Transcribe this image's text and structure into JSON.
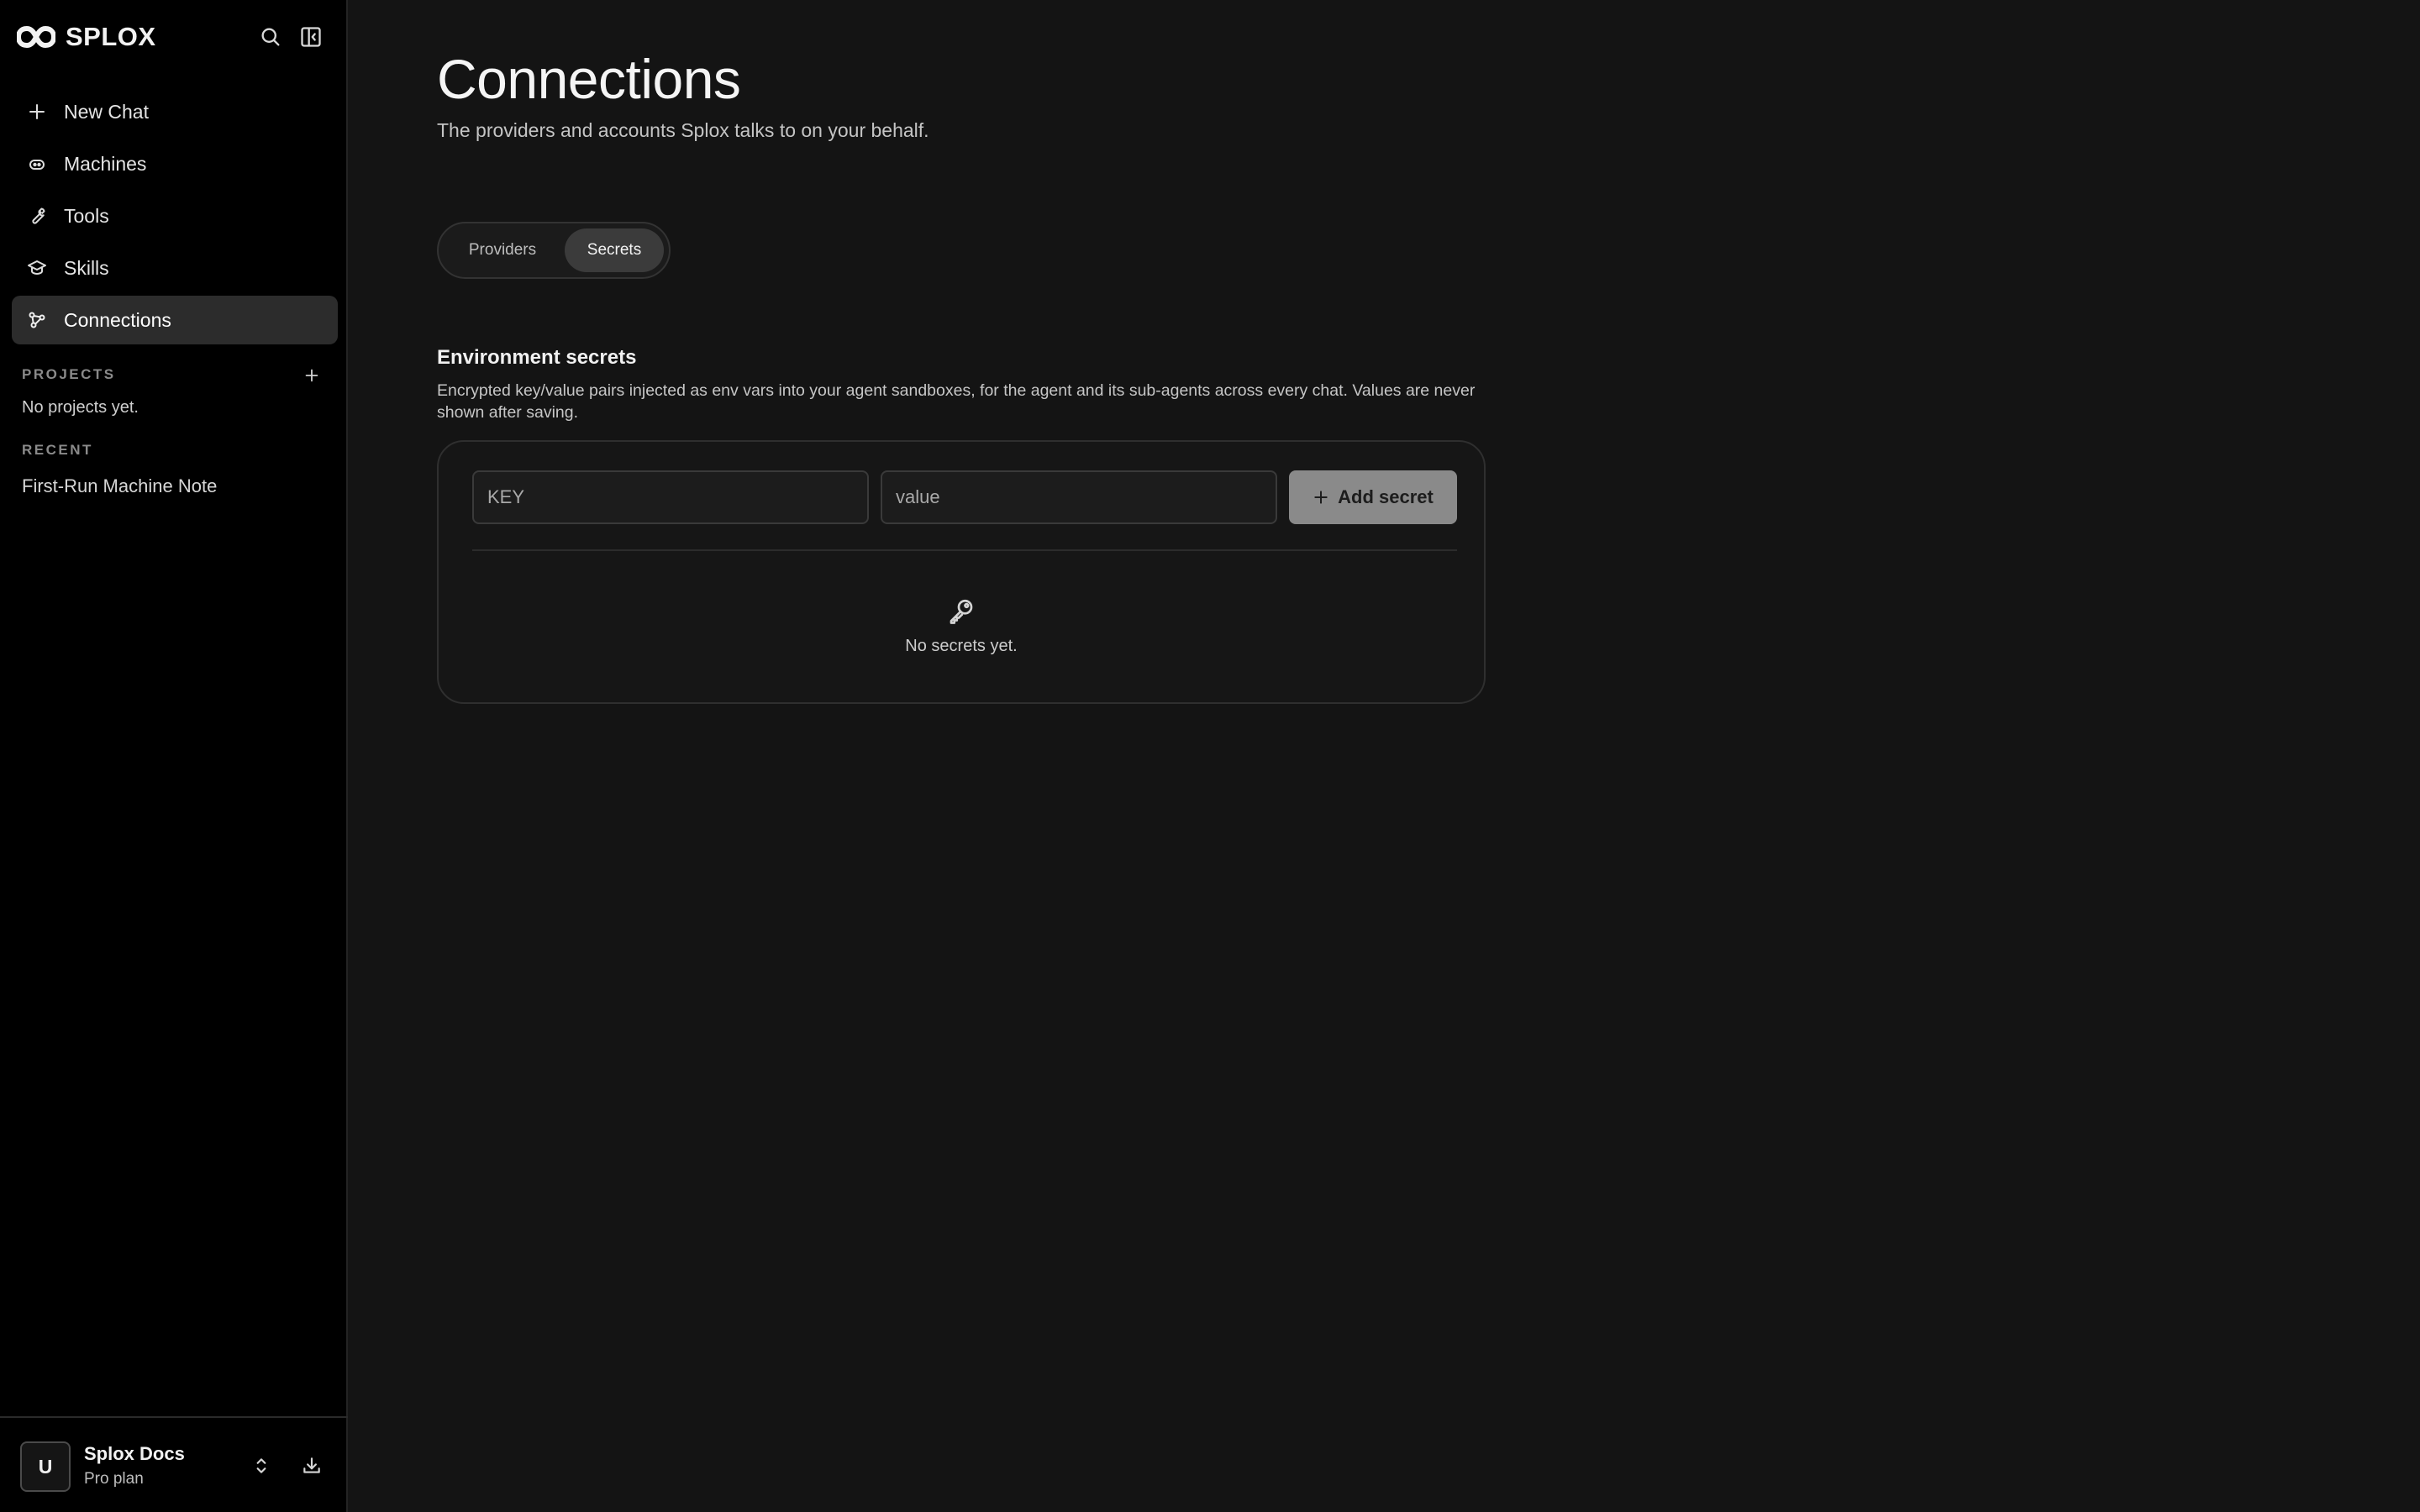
{
  "app": {
    "brand": "SPLOX"
  },
  "sidebar": {
    "nav": [
      {
        "label": "New Chat",
        "icon": "plus-icon"
      },
      {
        "label": "Machines",
        "icon": "robot-icon"
      },
      {
        "label": "Tools",
        "icon": "wrench-icon"
      },
      {
        "label": "Skills",
        "icon": "graduation-cap-icon"
      },
      {
        "label": "Connections",
        "icon": "connections-icon",
        "active": true
      }
    ],
    "projects": {
      "label": "PROJECTS",
      "empty": "No projects yet."
    },
    "recent": {
      "label": "RECENT",
      "items": [
        "First-Run Machine Note"
      ]
    },
    "account": {
      "initial": "U",
      "name": "Splox Docs",
      "plan": "Pro plan"
    }
  },
  "main": {
    "title": "Connections",
    "subtitle": "The providers and accounts Splox talks to on your behalf.",
    "tabs": [
      {
        "label": "Providers",
        "selected": false
      },
      {
        "label": "Secrets",
        "selected": true
      }
    ],
    "secrets": {
      "title": "Environment secrets",
      "description": "Encrypted key/value pairs injected as env vars into your agent sandboxes, for the agent and its sub-agents across every chat. Values are never shown after saving.",
      "key_placeholder": "KEY",
      "value_placeholder": "value",
      "add_label": "Add secret",
      "empty": "No secrets yet."
    }
  },
  "colors": {
    "sidebar_bg": "#000000",
    "main_bg": "#141414",
    "active_nav": "#2c2c2c",
    "button_bg": "#8a8a8a"
  }
}
